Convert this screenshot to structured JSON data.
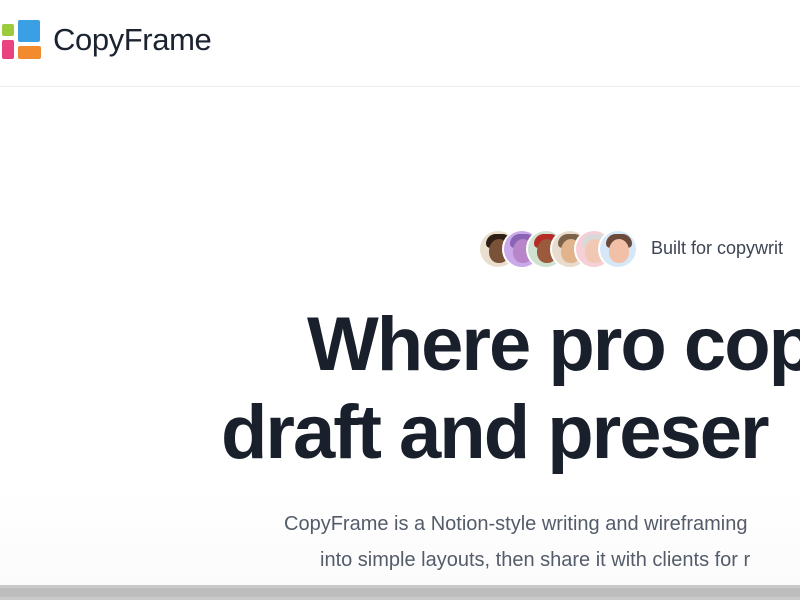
{
  "header": {
    "brand": "CopyFrame",
    "logo_colors": [
      "#9ccc3d",
      "#3b9fe3",
      "#e8427f",
      "#f28b2e"
    ]
  },
  "hero": {
    "avatars": [
      {
        "icon": "memoji-avatar-1",
        "bg": "#eadfcf",
        "face": "#7a5238",
        "hair": "#2d1e16"
      },
      {
        "icon": "memoji-avatar-2",
        "bg": "#c9a9e9",
        "face": "#b885c9",
        "hair": "#8b63b5"
      },
      {
        "icon": "memoji-avatar-3",
        "bg": "#cfe2d2",
        "face": "#9c5a3c",
        "hair": "#b52b26"
      },
      {
        "icon": "memoji-avatar-4",
        "bg": "#e7dccd",
        "face": "#e2b48b",
        "hair": "#7b6248"
      },
      {
        "icon": "memoji-avatar-5",
        "bg": "#f7cfd6",
        "face": "#f0c8b4",
        "hair": "#d9d9d9"
      },
      {
        "icon": "memoji-avatar-6",
        "bg": "#d6e8f8",
        "face": "#f1c0a6",
        "hair": "#6b4a3b"
      }
    ],
    "tagline": "Built for copywrit",
    "headline_line1": "Where pro cop",
    "headline_line2": "draft and preser",
    "description_line1": "CopyFrame is a Notion-style writing and wireframing",
    "description_line2": "into simple layouts, then share it with clients for r"
  }
}
